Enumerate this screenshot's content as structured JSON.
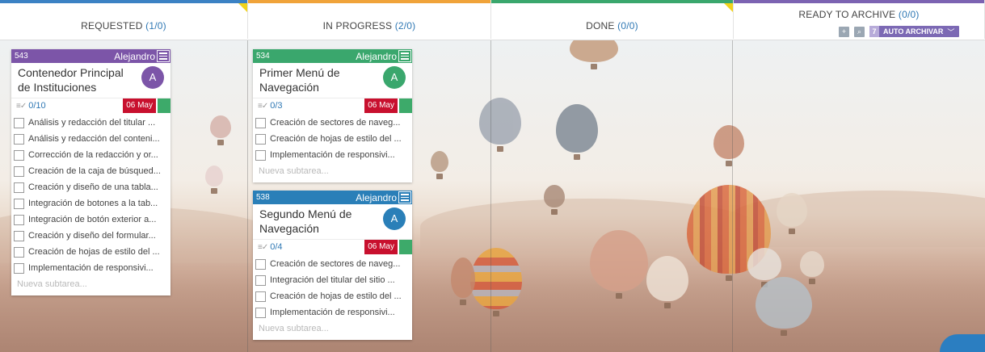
{
  "columns": [
    {
      "title": "REQUESTED",
      "count": "(1/0)",
      "accent": "#3b82c4"
    },
    {
      "title": "IN PROGRESS",
      "count": "(2/0)",
      "accent": "#f0a33a"
    },
    {
      "title": "DONE",
      "count": "(0/0)",
      "accent": "#3aa76d"
    },
    {
      "title": "READY TO ARCHIVE",
      "count": "(0/0)",
      "accent": "#7c63b2"
    }
  ],
  "archive_tools": {
    "auto_count": "7",
    "auto_label": "AUTO ARCHIVAR",
    "chevron": "﹀"
  },
  "cards": [
    {
      "id": "543",
      "user": "Alejandro",
      "color": "#7c55a8",
      "title": "Contenedor Principal de Instituciones",
      "avatar": "A",
      "avatar_color": "#7c55a8",
      "progress": "0/10",
      "date": "06 May",
      "subtasks": [
        "Análisis y redacción del titular ...",
        "Análisis y redacción del conteni...",
        "Corrección de la redacción y or...",
        "Creación de la caja de búsqued...",
        "Creación y diseño de una tabla...",
        "Integración de botones a la tab...",
        "Integración de botón exterior a...",
        "Creación y diseño del formular...",
        "Creación de hojas de estilo del ...",
        "Implementación de responsivi..."
      ],
      "new_subtask": "Nueva subtarea..."
    },
    {
      "id": "534",
      "user": "Alejandro",
      "color": "#3aa76d",
      "title": "Primer Menú de Navegación",
      "avatar": "A",
      "avatar_color": "#3aa76d",
      "progress": "0/3",
      "date": "06 May",
      "subtasks": [
        "Creación de sectores de naveg...",
        "Creación de hojas de estilo del ...",
        "Implementación de responsivi..."
      ],
      "new_subtask": "Nueva subtarea..."
    },
    {
      "id": "538",
      "user": "Alejandro",
      "color": "#2a7fb8",
      "title": "Segundo Menú de Navegación",
      "avatar": "A",
      "avatar_color": "#2a7fb8",
      "progress": "0/4",
      "date": "06 May",
      "subtasks": [
        "Creación de sectores de naveg...",
        "Integración del titular del sitio ...",
        "Creación de hojas de estilo del ...",
        "Implementación de responsivi..."
      ],
      "new_subtask": "Nueva subtarea..."
    }
  ]
}
